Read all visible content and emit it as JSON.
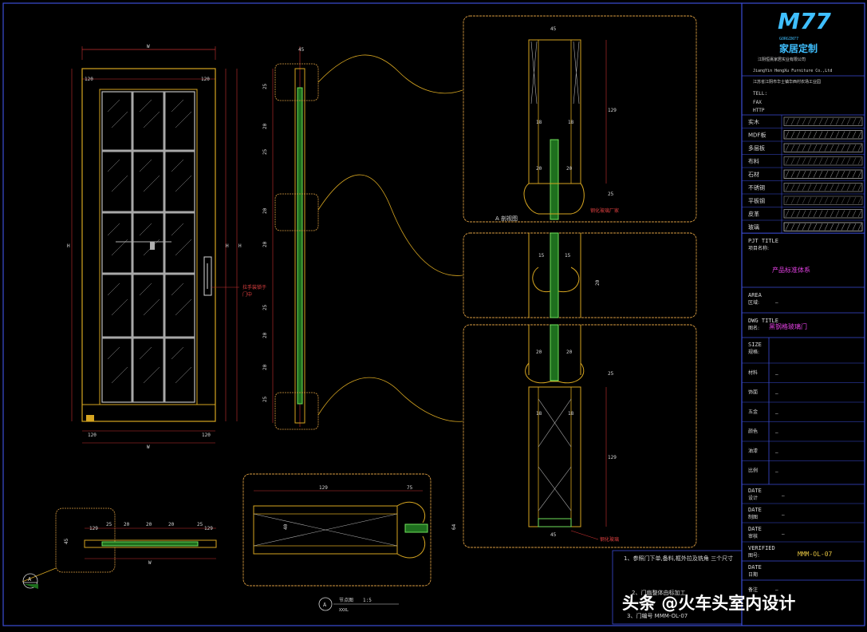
{
  "brand": {
    "logo_text": "M77",
    "logo_subtitle": "家居定制",
    "logo_small": "GORGIN77",
    "company_cn": "江阴恒熹家居实业有限公司",
    "company_en": "JiangYin HengXu Furniture Co.,Ltd",
    "address_line": "江苏省江阴市华士镇华西村农场工业园",
    "contact_labels": [
      "TELL:",
      "FAX",
      "HTTP"
    ]
  },
  "legend": [
    {
      "label": "实木"
    },
    {
      "label": "MDF板"
    },
    {
      "label": "多层板"
    },
    {
      "label": "布料"
    },
    {
      "label": "石材"
    },
    {
      "label": "不锈钢"
    },
    {
      "label": "平板钢"
    },
    {
      "label": "皮革"
    },
    {
      "label": "玻璃"
    }
  ],
  "title_block": {
    "pjt_title_label": "PJT TITLE",
    "pjt_title_cn": "项目名称:",
    "pjt_title_value": "产品标准体系",
    "area_label": "AREA",
    "area_cn": "区域:",
    "area_value": "—",
    "dwg_title_label": "DWG TITLE",
    "dwg_title_cn": "图名:",
    "dwg_title_value": "黑钢格玻璃门",
    "size_label": "SIZE",
    "size_cn": "规格:",
    "rows": [
      {
        "label": "材料",
        "value": "—"
      },
      {
        "label": "饰面",
        "value": "—"
      },
      {
        "label": "五金",
        "value": "—"
      },
      {
        "label": "颜色",
        "value": "—"
      },
      {
        "label": "油漆",
        "value": "—"
      },
      {
        "label": "比例",
        "value": "—"
      }
    ],
    "date_rows": [
      {
        "label": "DATE",
        "cn": "设计",
        "value": "—"
      },
      {
        "label": "DATE",
        "cn": "制图",
        "value": "—"
      },
      {
        "label": "DATE",
        "cn": "审核",
        "value": "—"
      }
    ],
    "verified_label": "VERIFIED",
    "verified_cn": "图号:",
    "drawing_no": "MMM-OL-07",
    "last_date_label": "DATE",
    "last_date_cn": "日期",
    "remarks_label": "备注",
    "tail_value": "—"
  },
  "notes": [
    "1、参照门下单,备料,框外拉及铣角 三个尺寸",
    "2、门扇整体由标加工",
    "3、门编号 MMM-OL-07"
  ],
  "labels": {
    "section_a": "A 剖视图",
    "detail_a": "节点图",
    "detail_scale": "1:5",
    "detail_sub": "XXXL",
    "handle_note": "拉手装锁于",
    "handle_note2": "门中",
    "glass_note": "钢化玻璃厂家",
    "bottom_note": "钢化玻璃",
    "a_marker": "A"
  },
  "dims": {
    "w": "W",
    "h": "H",
    "d120": "120",
    "d45": "45",
    "d25": "25",
    "d20": "20",
    "d15": "15",
    "d18": "18",
    "d129": "129",
    "d75": "75",
    "d64": "64",
    "d40": "40"
  },
  "watermark": "头条 @火车头室内设计"
}
